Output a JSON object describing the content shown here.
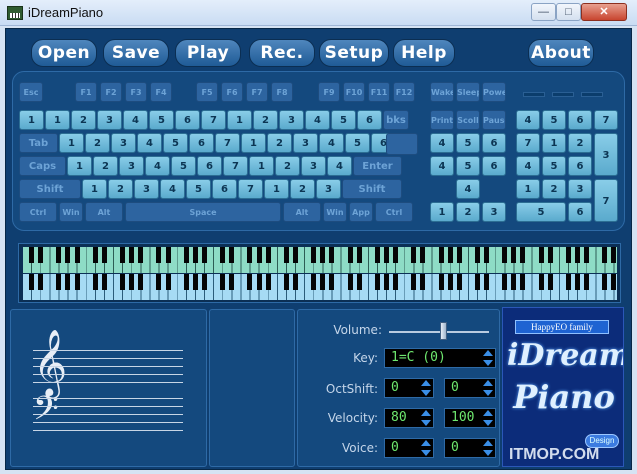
{
  "window": {
    "title": "iDreamPiano",
    "min_label": "—",
    "max_label": "□",
    "close_label": "✕"
  },
  "toolbar": {
    "open": "Open",
    "save": "Save",
    "play": "Play",
    "rec": "Rec.",
    "setup": "Setup",
    "help": "Help",
    "about": "About"
  },
  "keyboard": {
    "fn_row": [
      "Esc",
      "F1",
      "F2",
      "F3",
      "F4",
      "F5",
      "F6",
      "F7",
      "F8",
      "F9",
      "F10",
      "F11",
      "F12",
      "Wake",
      "Sleep",
      "Power"
    ],
    "row1": [
      {
        "l": "",
        "n": "1"
      },
      {
        "l": "",
        "n": "1"
      },
      {
        "l": "",
        "n": "2"
      },
      {
        "l": "",
        "n": "3"
      },
      {
        "l": "",
        "n": "4"
      },
      {
        "l": "",
        "n": "5"
      },
      {
        "l": "",
        "n": "6"
      },
      {
        "l": "",
        "n": "7"
      },
      {
        "l": "",
        "n": "1"
      },
      {
        "l": "",
        "n": "2"
      },
      {
        "l": "",
        "n": "3"
      },
      {
        "l": "",
        "n": "4"
      },
      {
        "l": "",
        "n": "5"
      },
      {
        "l": "",
        "n": "6"
      },
      {
        "l": "bks",
        "n": ""
      }
    ],
    "row2": [
      {
        "l": "Tab",
        "n": ""
      },
      {
        "l": "",
        "n": "1"
      },
      {
        "l": "",
        "n": "2"
      },
      {
        "l": "",
        "n": "3"
      },
      {
        "l": "",
        "n": "4"
      },
      {
        "l": "",
        "n": "5"
      },
      {
        "l": "",
        "n": "6"
      },
      {
        "l": "",
        "n": "7"
      },
      {
        "l": "",
        "n": "1"
      },
      {
        "l": "",
        "n": "2"
      },
      {
        "l": "",
        "n": "3"
      },
      {
        "l": "",
        "n": "4"
      },
      {
        "l": "",
        "n": "5"
      },
      {
        "l": "",
        "n": "6"
      }
    ],
    "row3": [
      {
        "l": "Caps",
        "n": ""
      },
      {
        "l": "",
        "n": "1"
      },
      {
        "l": "",
        "n": "2"
      },
      {
        "l": "",
        "n": "3"
      },
      {
        "l": "",
        "n": "4"
      },
      {
        "l": "",
        "n": "5"
      },
      {
        "l": "",
        "n": "6"
      },
      {
        "l": "",
        "n": "7"
      },
      {
        "l": "",
        "n": "1"
      },
      {
        "l": "",
        "n": "2"
      },
      {
        "l": "",
        "n": "3"
      },
      {
        "l": "",
        "n": "4"
      },
      {
        "l": "Enter",
        "n": ""
      }
    ],
    "row4": [
      {
        "l": "Shift",
        "n": ""
      },
      {
        "l": "",
        "n": "1"
      },
      {
        "l": "",
        "n": "2"
      },
      {
        "l": "",
        "n": "3"
      },
      {
        "l": "",
        "n": "4"
      },
      {
        "l": "",
        "n": "5"
      },
      {
        "l": "",
        "n": "6"
      },
      {
        "l": "",
        "n": "7"
      },
      {
        "l": "",
        "n": "1"
      },
      {
        "l": "",
        "n": "2"
      },
      {
        "l": "",
        "n": "3"
      },
      {
        "l": "Shift",
        "n": ""
      }
    ],
    "row5": [
      "Ctrl",
      "Win",
      "Alt",
      "Space",
      "Alt",
      "Win",
      "App",
      "Ctrl"
    ],
    "nav": [
      "Print",
      "Scoll",
      "Pause",
      "4",
      "5",
      "6",
      "4",
      "5",
      "6",
      "1",
      "2",
      "3",
      "4",
      "1",
      "2",
      "3"
    ],
    "numpad": [
      "4",
      "5",
      "6",
      "7",
      "7",
      "1",
      "2",
      "3",
      "4",
      "5",
      "6",
      "1",
      "2",
      "3",
      "5",
      "6",
      "7"
    ]
  },
  "controls": {
    "volume_label": "Volume:",
    "volume_level": 0.55,
    "key_label": "Key:",
    "key_value": "1=C (0)",
    "octshift_label": "OctShift:",
    "octshift_a": "0",
    "octshift_b": "0",
    "velocity_label": "Velocity:",
    "velocity_a": "80",
    "velocity_b": "100",
    "voice_label": "Voice:",
    "voice_a": "0",
    "voice_b": "0"
  },
  "logo": {
    "family": "HappyEO family",
    "word1": "iDream",
    "word2": "Piano",
    "design": "Design",
    "watermark": "ITMOP.COM"
  }
}
